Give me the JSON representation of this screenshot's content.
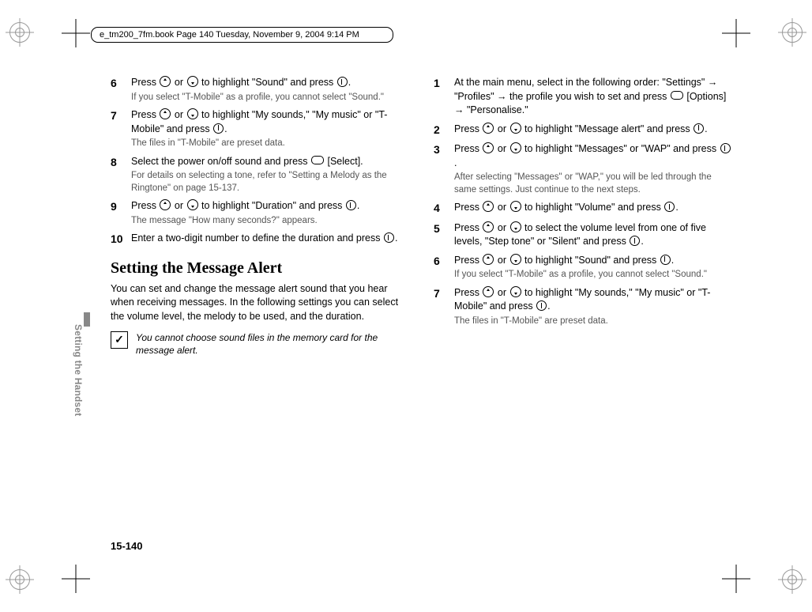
{
  "header": "e_tm200_7fm.book  Page 140  Tuesday, November 9, 2004  9:14 PM",
  "sidetab": "Setting the Handset",
  "page_num": "15-140",
  "left": {
    "steps": [
      {
        "num": "6",
        "text_a": "Press ",
        "text_b": " or ",
        "text_c": " to highlight \"Sound\" and press ",
        "text_d": ".",
        "note": "If you select \"T-Mobile\" as a profile, you cannot select \"Sound.\""
      },
      {
        "num": "7",
        "text_a": "Press ",
        "text_b": " or ",
        "text_c": " to highlight \"My sounds,\" \"My music\" or \"T-Mobile\" and press ",
        "text_d": ".",
        "note": "The files in \"T-Mobile\" are preset data."
      },
      {
        "num": "8",
        "text_a": "Select the power on/off sound and press ",
        "text_b": " [Select].",
        "note": "For details on selecting a tone, refer to \"Setting a Melody as the Ringtone\" on page 15-137."
      },
      {
        "num": "9",
        "text_a": "Press ",
        "text_b": " or ",
        "text_c": " to highlight \"Duration\" and press ",
        "text_d": ".",
        "note": "The message \"How many seconds?\" appears."
      },
      {
        "num": "10",
        "text_a": "Enter a two-digit number to define the duration and press ",
        "text_b": "."
      }
    ],
    "section_title": "Setting the Message Alert",
    "intro": "You can set and change the message alert sound that you hear when receiving messages. In the following settings you can select the volume level, the melody to be used, and the duration.",
    "tip": "You cannot choose sound files in the memory card for the message alert."
  },
  "right": {
    "steps": [
      {
        "num": "1",
        "text": "At the main menu, select in the following order: \"Settings\" → \"Profiles\" → the profile you wish to set and press ",
        "text_b": " [Options] → \"Personalise.\""
      },
      {
        "num": "2",
        "text_a": "Press ",
        "text_b": " or ",
        "text_c": " to highlight \"Message alert\" and press ",
        "text_d": "."
      },
      {
        "num": "3",
        "text_a": "Press ",
        "text_b": " or ",
        "text_c": " to highlight \"Messages\" or \"WAP\" and press ",
        "text_d": ".",
        "note": "After selecting \"Messages\" or \"WAP,\" you will be led through the same settings. Just continue to the next steps."
      },
      {
        "num": "4",
        "text_a": "Press ",
        "text_b": " or ",
        "text_c": " to highlight \"Volume\" and press ",
        "text_d": "."
      },
      {
        "num": "5",
        "text_a": "Press ",
        "text_b": " or ",
        "text_c": " to select the volume level from one of five levels, \"Step tone\" or \"Silent\" and press ",
        "text_d": "."
      },
      {
        "num": "6",
        "text_a": "Press ",
        "text_b": " or ",
        "text_c": " to highlight \"Sound\" and press ",
        "text_d": ".",
        "note": "If you select \"T-Mobile\" as a profile, you cannot select \"Sound.\""
      },
      {
        "num": "7",
        "text_a": "Press ",
        "text_b": " or ",
        "text_c": " to highlight \"My sounds,\" \"My music\" or \"T-Mobile\" and press ",
        "text_d": ".",
        "note": "The files in \"T-Mobile\" are preset data."
      }
    ]
  }
}
